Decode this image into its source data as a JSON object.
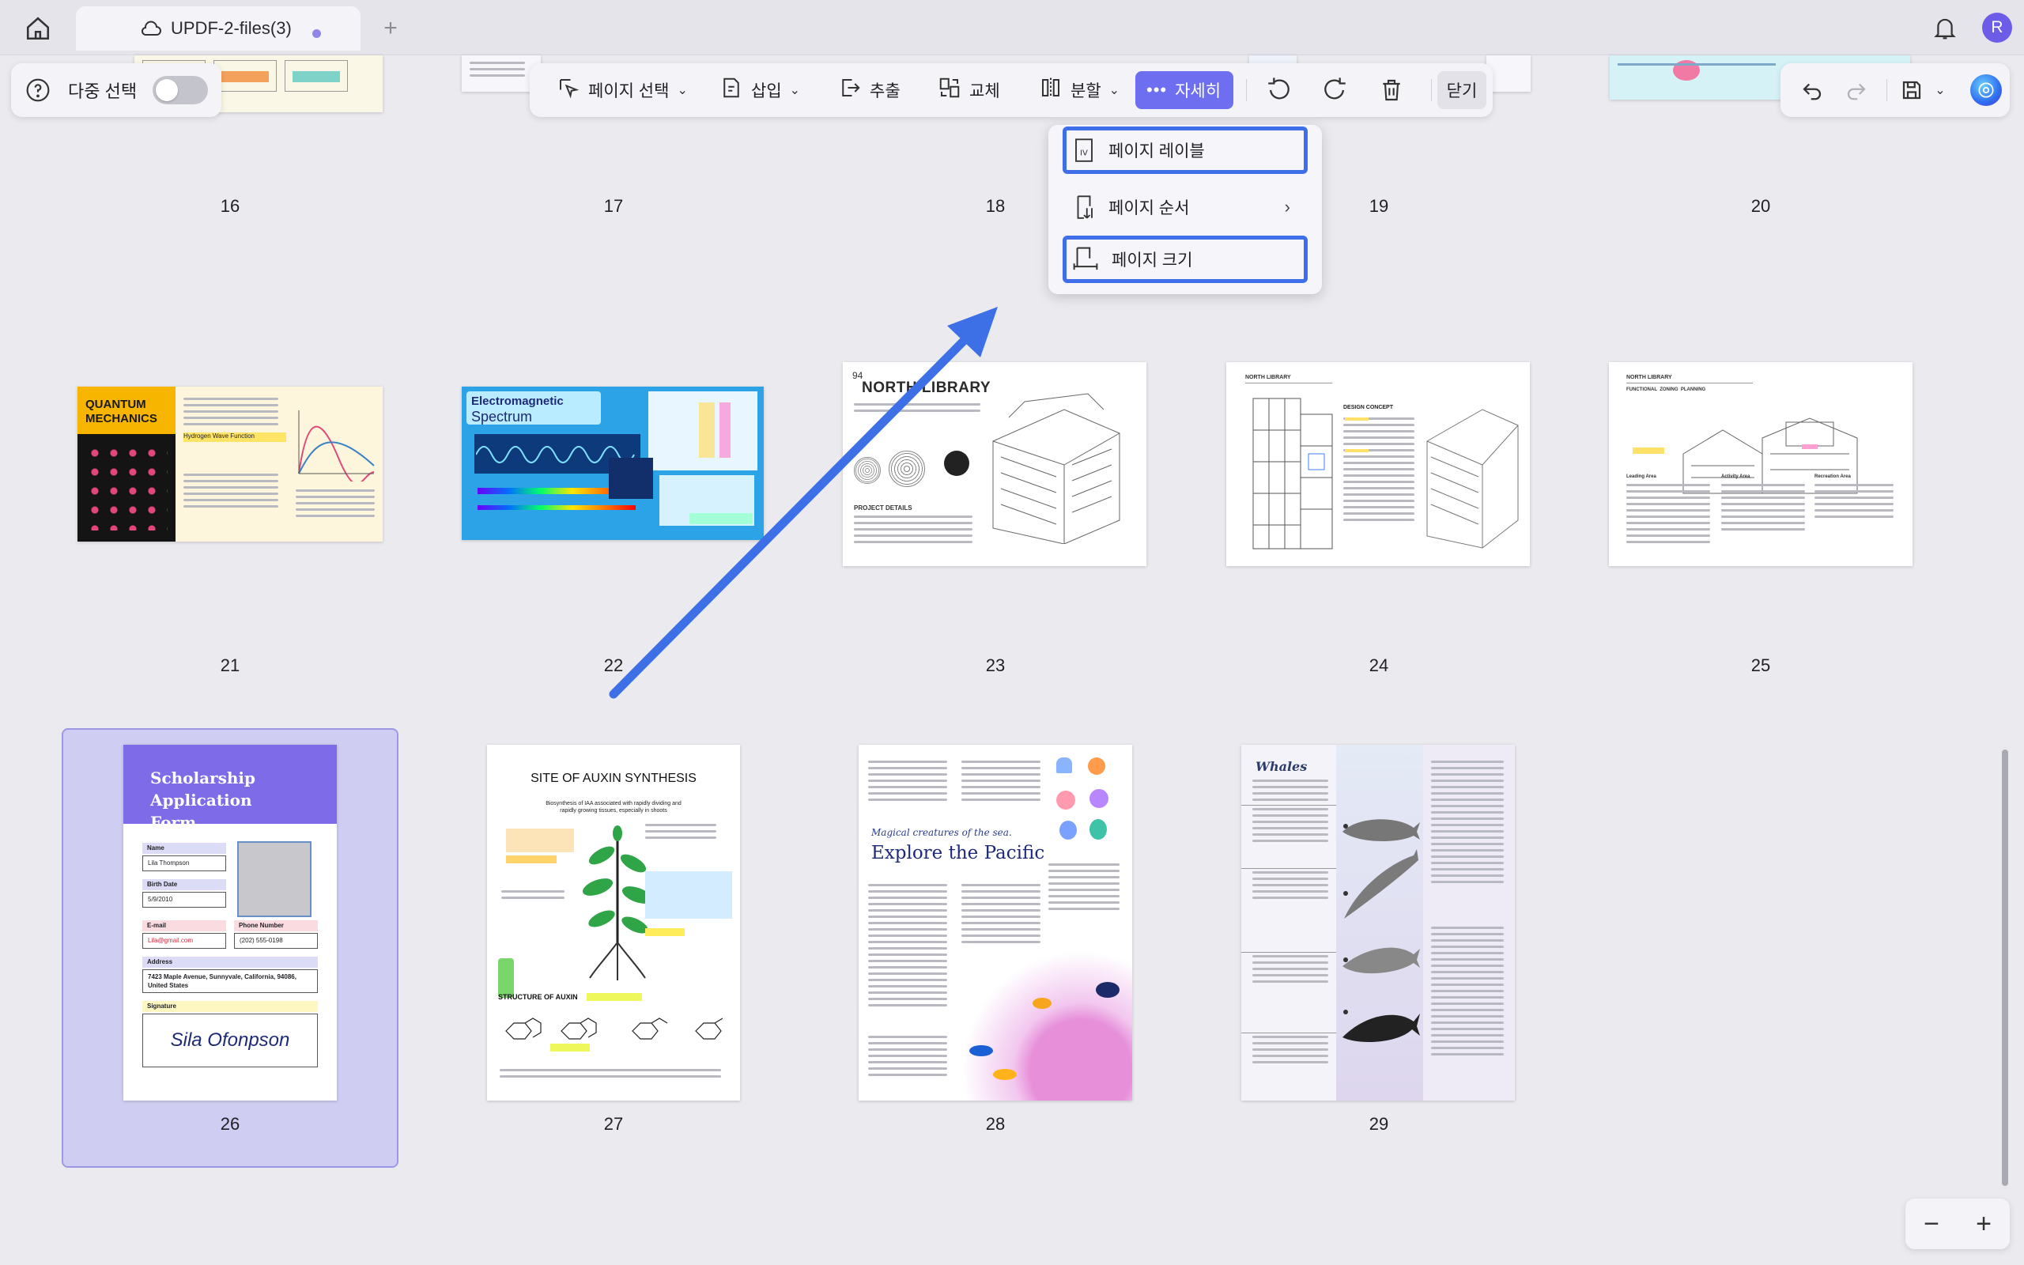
{
  "tab": {
    "title": "UPDF-2-files(3)"
  },
  "user": {
    "initial": "R"
  },
  "left_panel": {
    "multi_select_label": "다중 선택"
  },
  "toolbar": {
    "page_select": "페이지 선택",
    "insert": "삽입",
    "extract": "추출",
    "replace": "교체",
    "split": "분할",
    "more": "자세히",
    "close": "닫기"
  },
  "dropdown": {
    "items": [
      {
        "label": "페이지 레이블",
        "icon": "page-label-icon"
      },
      {
        "label": "페이지 순서",
        "icon": "page-order-icon"
      },
      {
        "label": "페이지 크기",
        "icon": "page-size-icon"
      }
    ]
  },
  "pages": {
    "row1": [
      "16",
      "17",
      "18",
      "19",
      "20"
    ],
    "row2": [
      "21",
      "22",
      "23",
      "24",
      "25"
    ],
    "row3": [
      "26",
      "27",
      "28",
      "29"
    ]
  },
  "thumbs": {
    "p21": {
      "title": "QUANTUM MECHANICS",
      "sub": "Hydrogen Wave Function"
    },
    "p22": {
      "title": "Electromagnetic",
      "title2": "Spectrum"
    },
    "p23": {
      "num": "94",
      "title": "NORTH LIBRARY",
      "project": "PROJECT DETAILS"
    },
    "p24": {
      "header": "NORTH LIBRARY",
      "concept": "DESIGN CONCEPT"
    },
    "p25": {
      "header": "NORTH LIBRARY",
      "sub": "FUNCTIONAL  ZONING  PLANNING",
      "area1": "Leading Area",
      "area2": "Activity Area",
      "area3": "Recreation Area"
    },
    "p26": {
      "title": "Scholarship Application Form",
      "name_label": "Name",
      "name": "Lila Thompson",
      "birth_label": "Birth Date",
      "birth": "5/9/2010",
      "email_label": "E-mail",
      "email": "Lila@gmail.com",
      "phone_label": "Phone Number",
      "phone": "(202) 555-0198",
      "address_label": "Address",
      "address": "7423 Maple Avenue, Sunnyvale, California, 94086, United States",
      "signature_label": "Signature",
      "signature": "Sila Ofonpson"
    },
    "p27": {
      "title": "SITE OF AUXIN SYNTHESIS",
      "sub": "Biosynthesis of IAA associated with rapidly dividing and rapidly growing tissues, especially in shoots",
      "structure": "STRUCTURE OF AUXIN"
    },
    "p28": {
      "kicker": "Magical creatures of the sea.",
      "title": "Explore the Pacific"
    },
    "p29": {
      "title": "Whales"
    }
  },
  "colors": {
    "accent": "#6d6ef0",
    "highlight": "#3f6fe8",
    "selection": "#cfcdf1"
  }
}
